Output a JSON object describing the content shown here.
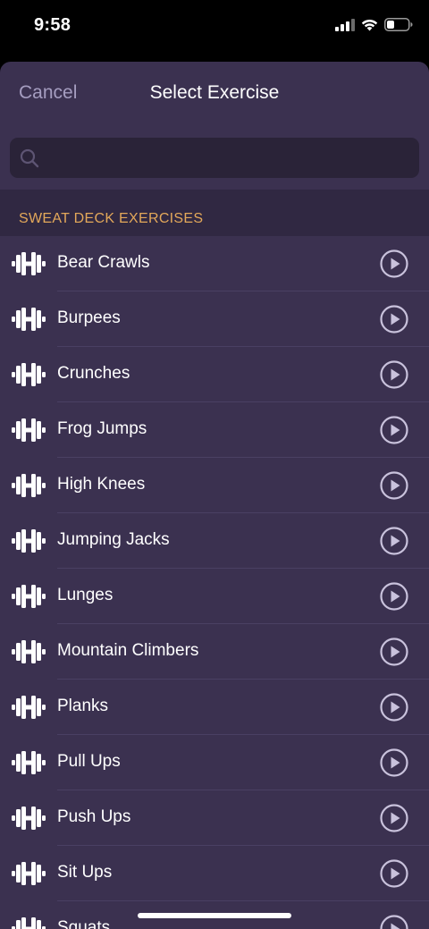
{
  "status_bar": {
    "time": "9:58"
  },
  "nav": {
    "cancel_label": "Cancel",
    "title": "Select Exercise"
  },
  "search": {
    "placeholder": "",
    "value": ""
  },
  "section": {
    "title": "SWEAT DECK EXERCISES"
  },
  "exercises": [
    {
      "label": "Bear Crawls"
    },
    {
      "label": "Burpees"
    },
    {
      "label": "Crunches"
    },
    {
      "label": "Frog Jumps"
    },
    {
      "label": "High Knees"
    },
    {
      "label": "Jumping Jacks"
    },
    {
      "label": "Lunges"
    },
    {
      "label": "Mountain Climbers"
    },
    {
      "label": "Planks"
    },
    {
      "label": "Pull Ups"
    },
    {
      "label": "Push Ups"
    },
    {
      "label": "Sit Ups"
    },
    {
      "label": "Squats"
    }
  ],
  "icons": {
    "row_icon": "dumbbell-icon",
    "row_action": "play-icon",
    "search": "search-icon"
  },
  "colors": {
    "sheet_background": "#3b3150",
    "section_header_background": "#302842",
    "section_title": "#e3a85a",
    "cancel": "#a59dc0",
    "play_icon": "#c9c2dc"
  }
}
